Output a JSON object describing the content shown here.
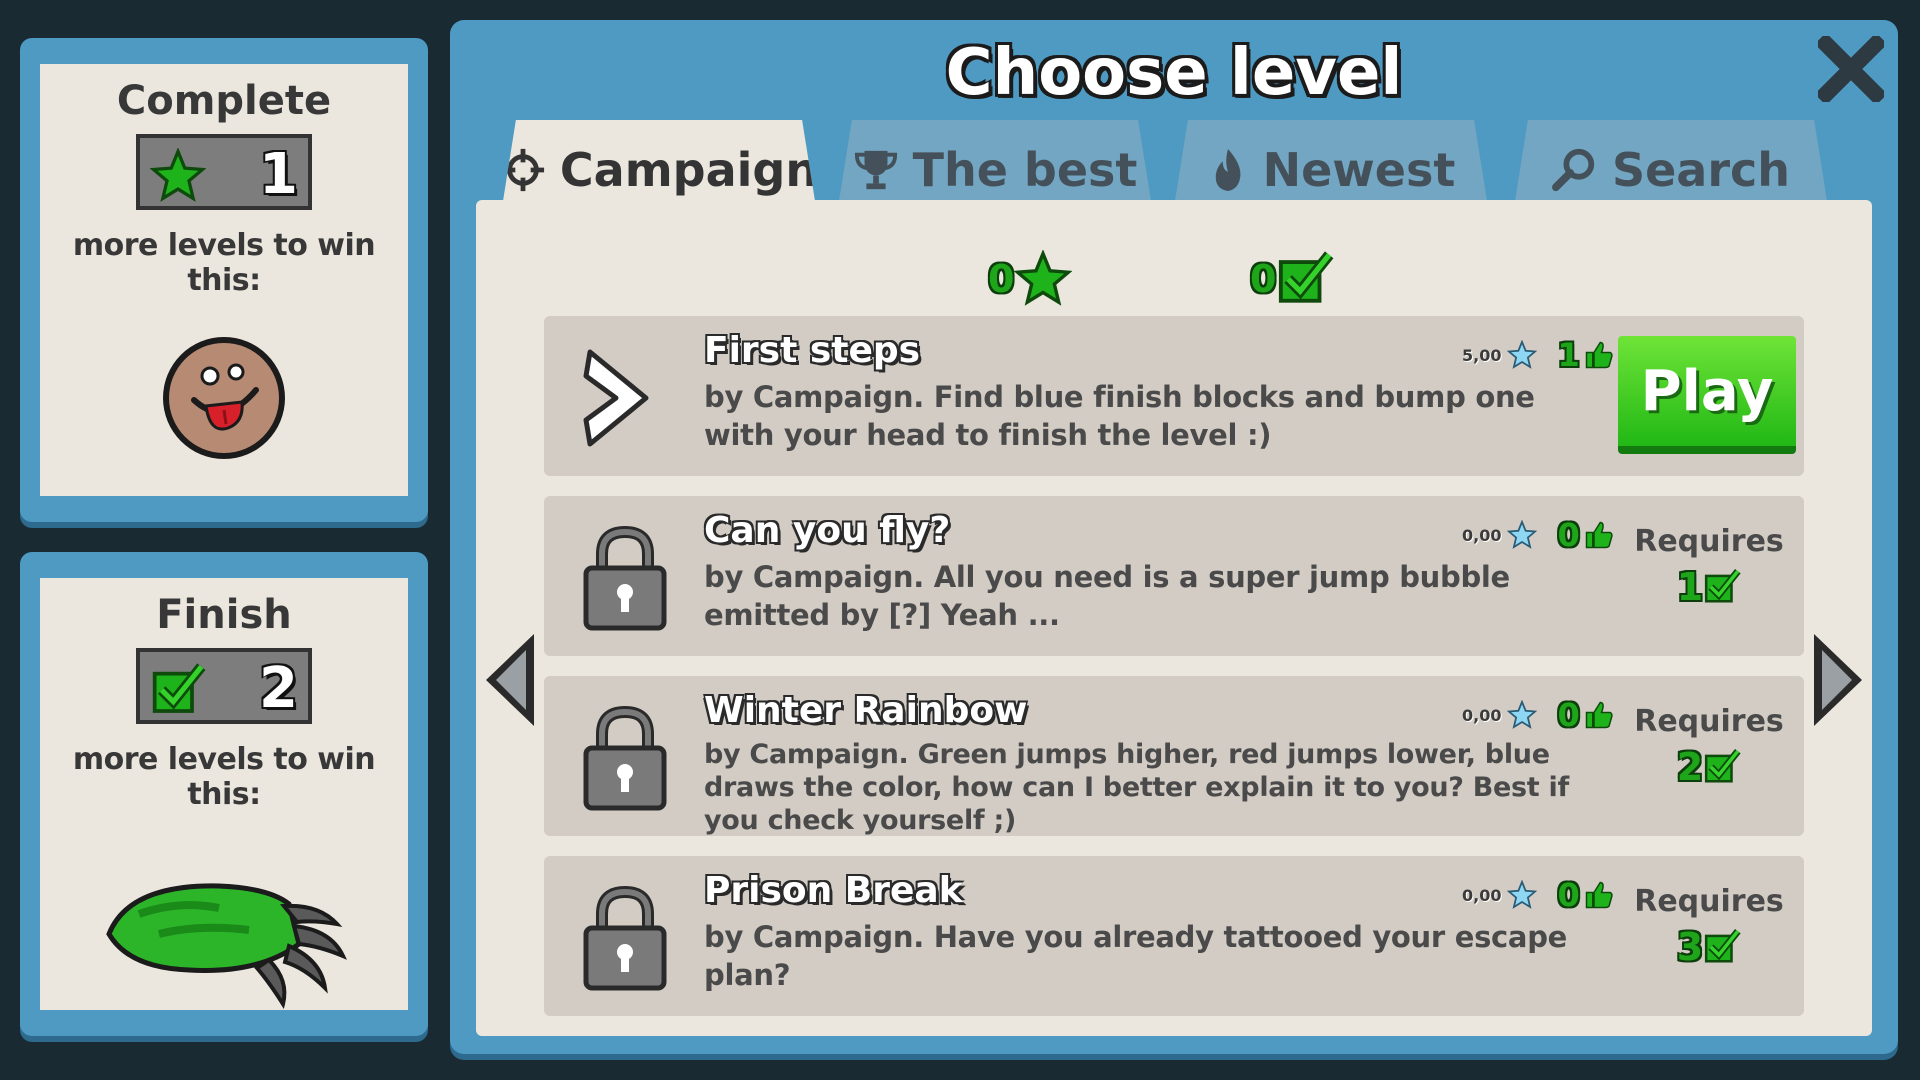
{
  "colors": {
    "green": "#22b816",
    "panel_blue": "#4f9ac3",
    "content_bg": "#ece7de",
    "row_bg": "#d3ccc5"
  },
  "side_panels": [
    {
      "title": "Complete",
      "count": "1",
      "icon": "star-icon",
      "subtitle": "more levels to win this:",
      "reward": "tongue-face-reward"
    },
    {
      "title": "Finish",
      "count": "2",
      "icon": "check-icon",
      "subtitle": "more levels to win this:",
      "reward": "green-claw-reward"
    }
  ],
  "dialog": {
    "title": "Choose level",
    "close_icon": "close-icon",
    "tabs": [
      {
        "label": "Campaign",
        "icon": "crosshair-icon",
        "active": true
      },
      {
        "label": "The best",
        "icon": "trophy-icon",
        "active": false
      },
      {
        "label": "Newest",
        "icon": "flame-icon",
        "active": false
      },
      {
        "label": "Search",
        "icon": "search-icon",
        "active": false
      }
    ],
    "totals": {
      "stars": "0",
      "completed": "0"
    },
    "levels": [
      {
        "name": "First steps",
        "description": "by Campaign. Find blue finish blocks and bump one with your head to finish the level :)",
        "rating": "5,00",
        "likes": "1",
        "state": "unlocked",
        "action_label": "Play"
      },
      {
        "name": "Can you fly?",
        "description": "by Campaign. All you need is a super jump bubble emitted by [?] Yeah ...",
        "rating": "0,00",
        "likes": "0",
        "state": "locked",
        "requires_label": "Requires",
        "requires_count": "1"
      },
      {
        "name": "Winter Rainbow",
        "description": "by Campaign. Green jumps higher, red jumps lower, blue draws the color, how can I better explain it to you? Best if you check yourself ;)",
        "rating": "0,00",
        "likes": "0",
        "state": "locked",
        "requires_label": "Requires",
        "requires_count": "2"
      },
      {
        "name": "Prison Break",
        "description": "by Campaign. Have you already tattooed your escape plan?",
        "rating": "0,00",
        "likes": "0",
        "state": "locked",
        "requires_label": "Requires",
        "requires_count": "3"
      }
    ],
    "nav": {
      "prev_icon": "arrow-left-icon",
      "next_icon": "arrow-right-icon"
    }
  }
}
